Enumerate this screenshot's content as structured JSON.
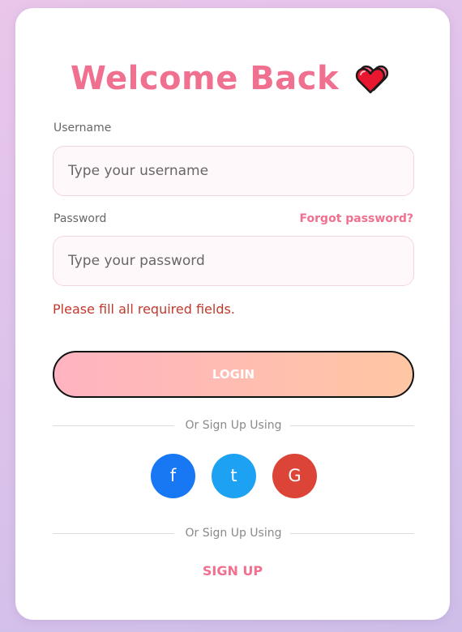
{
  "header": {
    "title": "Welcome Back"
  },
  "form": {
    "username_label": "Username",
    "username_placeholder": "Type your username",
    "username_value": "",
    "password_label": "Password",
    "password_placeholder": "Type your password",
    "password_value": "",
    "forgot_label": "Forgot password?",
    "error_message": "Please fill all required fields.",
    "login_label": "LOGIN"
  },
  "social": {
    "divider_text": "Or Sign Up Using",
    "facebook_label": "f",
    "twitter_label": "t",
    "google_label": "G"
  },
  "footer": {
    "divider_text": "Or Sign Up Using",
    "signup_label": "SIGN UP"
  },
  "colors": {
    "accent": "#f0708f",
    "error": "#c0392b",
    "facebook": "#1877f2",
    "twitter": "#1da1f2",
    "google": "#db4437"
  },
  "icons": {
    "title_icon": "two-hearts-icon"
  }
}
